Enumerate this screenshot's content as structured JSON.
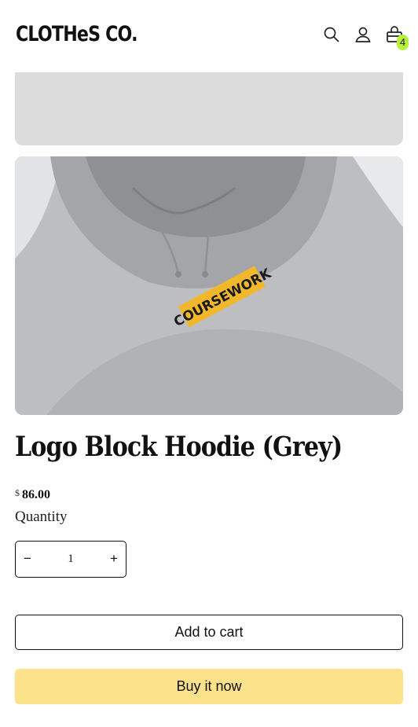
{
  "header": {
    "logo": "CLOTHeS CO.",
    "cart_count": "4",
    "icons": [
      "search-icon",
      "account-icon",
      "cart-icon"
    ]
  },
  "product": {
    "image_patch_text": "COURSEWORK",
    "title": "Logo Block Hoodie (Grey)",
    "currency": "$",
    "price": "86.00",
    "quantity_label": "Quantity",
    "quantity_value": "1",
    "minus_symbol": "−",
    "plus_symbol": "+",
    "add_to_cart": "Add to cart",
    "buy_now": "Buy it now"
  },
  "colors": {
    "badge": "#b6f23c",
    "buy_now_bg": "#fce28a",
    "patch": "#f2b82c"
  }
}
